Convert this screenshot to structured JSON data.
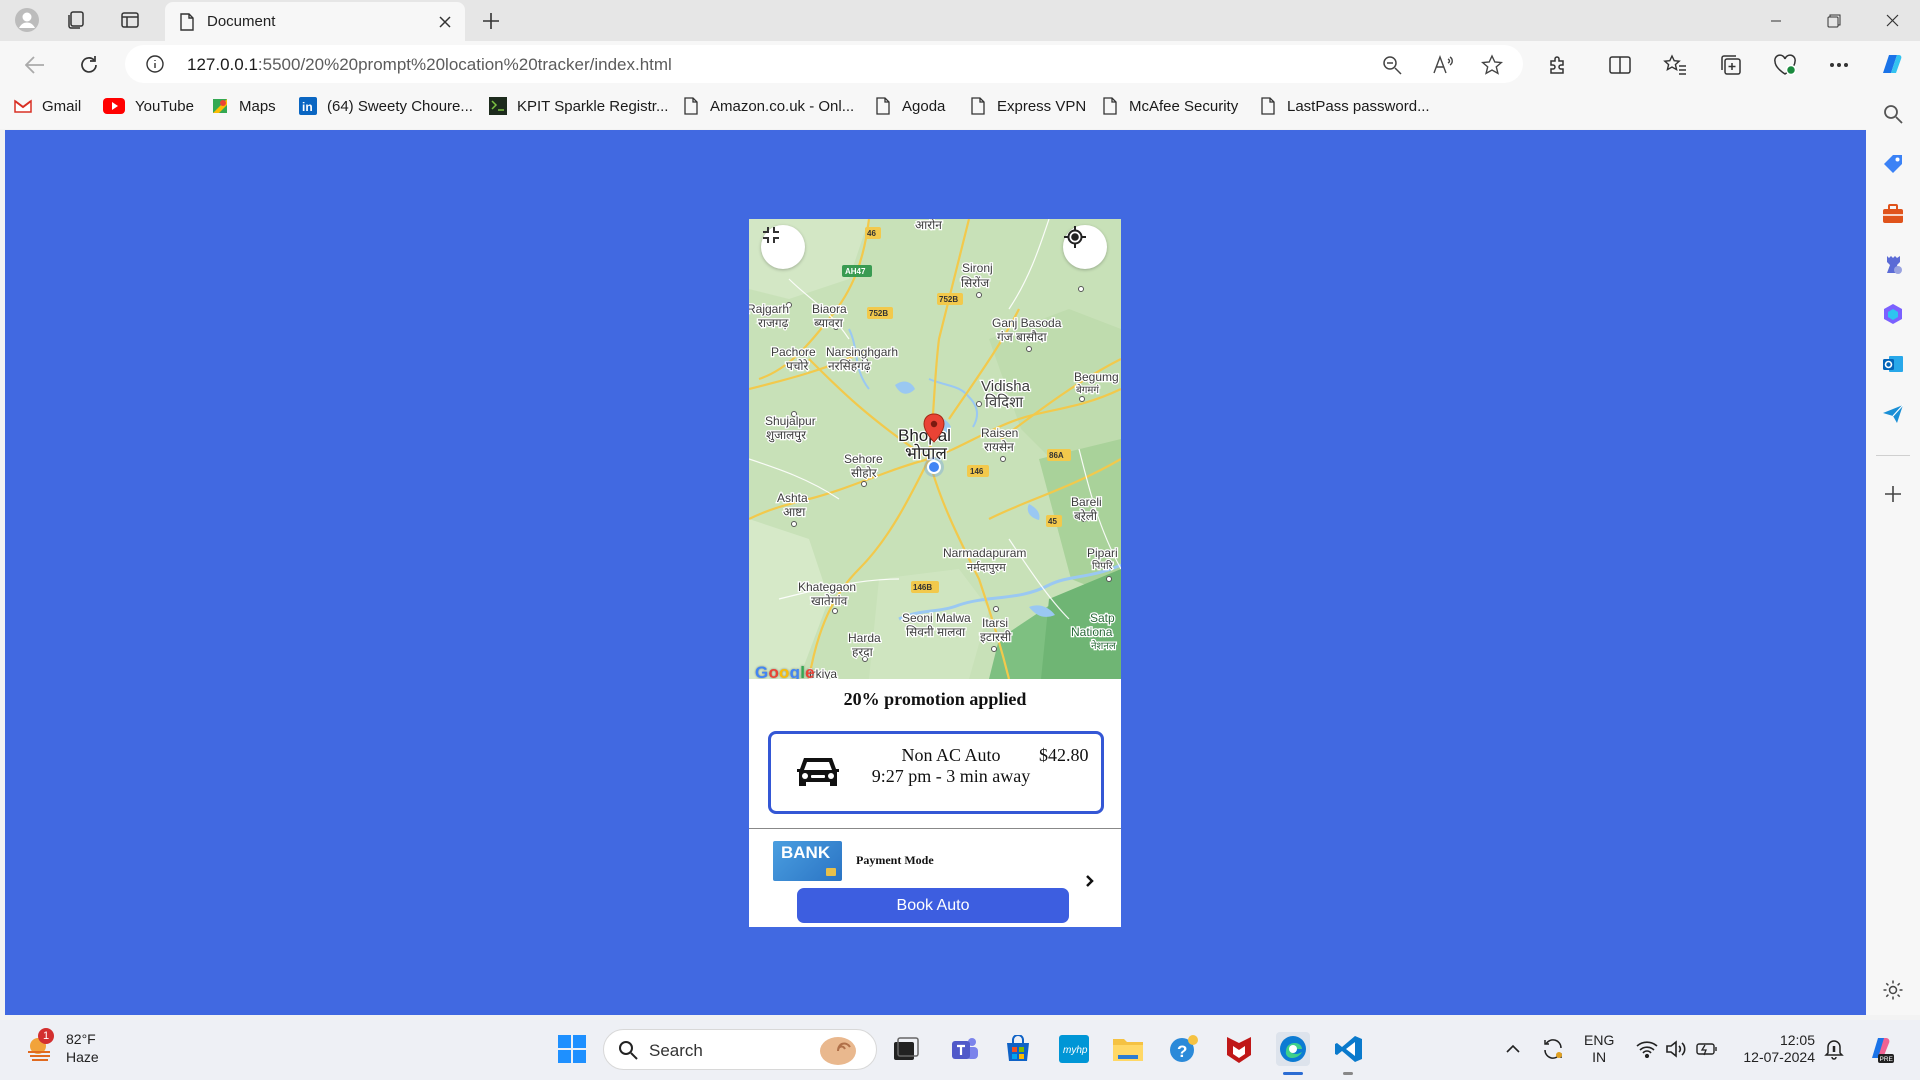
{
  "browser": {
    "tab_title": "Document",
    "url_host": "127.0.0.1",
    "url_path": ":5500/20%20prompt%20location%20tracker/index.html",
    "bookmarks": [
      {
        "label": "Gmail",
        "icon": "gmail-icon"
      },
      {
        "label": "YouTube",
        "icon": "youtube-icon"
      },
      {
        "label": "Maps",
        "icon": "maps-icon"
      },
      {
        "label": "(64) Sweety Choure...",
        "icon": "linkedin-icon"
      },
      {
        "label": "KPIT Sparkle Registr...",
        "icon": "kpit-icon"
      },
      {
        "label": "Amazon.co.uk - Onl...",
        "icon": "page-icon"
      },
      {
        "label": "Agoda",
        "icon": "page-icon"
      },
      {
        "label": "Express VPN",
        "icon": "page-icon"
      },
      {
        "label": "McAfee Security",
        "icon": "page-icon"
      },
      {
        "label": "LastPass password...",
        "icon": "page-icon"
      }
    ]
  },
  "colors": {
    "viewport_bg": "#4169e1",
    "accent": "#3d5ee0"
  },
  "map": {
    "provider": "Google",
    "places": [
      {
        "name": "आरोन"
      },
      {
        "name": "Sironj"
      },
      {
        "name": "सिरोंज"
      },
      {
        "name": "Rajgarh"
      },
      {
        "name": "राजगढ़"
      },
      {
        "name": "Biaora"
      },
      {
        "name": "ब्यावरा"
      },
      {
        "name": "Ganj Basoda"
      },
      {
        "name": "गंज बासौदा"
      },
      {
        "name": "Pachore"
      },
      {
        "name": "पचोरे"
      },
      {
        "name": "Narsinghgarh"
      },
      {
        "name": "नरसिंहगढ़"
      },
      {
        "name": "Begumg"
      },
      {
        "name": "बेगमगं"
      },
      {
        "name": "Vidisha"
      },
      {
        "name": "विदिशा"
      },
      {
        "name": "Shujalpur"
      },
      {
        "name": "शुजालपुर"
      },
      {
        "name": "Bhopal"
      },
      {
        "name": "भोपाल"
      },
      {
        "name": "Raisen"
      },
      {
        "name": "रायसेन"
      },
      {
        "name": "Sehore"
      },
      {
        "name": "सीहोर"
      },
      {
        "name": "Ashta"
      },
      {
        "name": "आष्टा"
      },
      {
        "name": "Bareli"
      },
      {
        "name": "बरेली"
      },
      {
        "name": "Narmadapuram"
      },
      {
        "name": "नर्मदापुरम"
      },
      {
        "name": "Pipari"
      },
      {
        "name": "पिपरि"
      },
      {
        "name": "Khategaon"
      },
      {
        "name": "खातेगांव"
      },
      {
        "name": "Seoni Malwa"
      },
      {
        "name": "सिवनी मालवा"
      },
      {
        "name": "Itarsi"
      },
      {
        "name": "इटारसी"
      },
      {
        "name": "Satp"
      },
      {
        "name": "Nationa"
      },
      {
        "name": "नेशनल"
      },
      {
        "name": "Harda"
      },
      {
        "name": "हरदा"
      },
      {
        "name": "irkiya"
      }
    ],
    "shields": [
      "46",
      "AH47",
      "752B",
      "752B",
      "146",
      "86A",
      "45",
      "146B"
    ]
  },
  "ride": {
    "promotion": "20% promotion applied",
    "vehicle": "Non AC Auto",
    "eta": "9:27 pm - 3 min away",
    "price": "$42.80",
    "payment_label": "Payment Mode",
    "bank_label": "BANK",
    "book_label": "Book Auto"
  },
  "taskbar": {
    "temp": "82°F",
    "condition": "Haze",
    "weather_badge": "1",
    "search_label": "Search",
    "lang": "ENG",
    "region": "IN",
    "time": "12:05",
    "date": "12-07-2024"
  }
}
